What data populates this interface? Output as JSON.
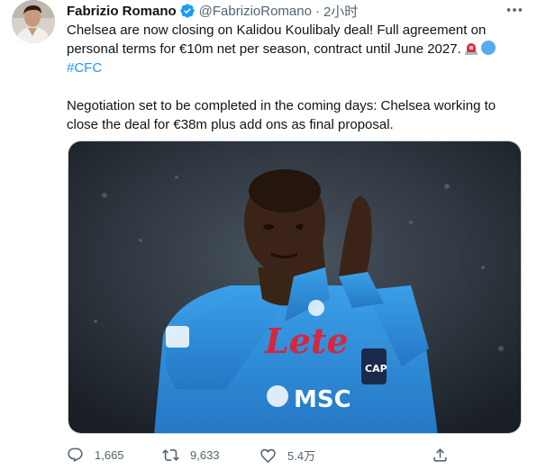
{
  "tweet": {
    "author_name": "Fabrizio Romano",
    "handle": "@FabrizioRomano",
    "separator": "·",
    "time": "2小时",
    "line1": "Chelsea are now closing on Kalidou Koulibaly deal! Full agreement on personal terms for €10m net per season, contract until June 2027.",
    "hashtag": "#CFC",
    "para2": "Negotiation set to be completed in the coming days: Chelsea working to close the deal for €38m plus add ons as final proposal."
  },
  "media": {
    "jersey_sponsor": "Lete",
    "jersey_logo": "MSC",
    "armband": "CAP"
  },
  "actions": {
    "reply_count": "1,665",
    "retweet_count": "9,633",
    "like_count": "5.4万"
  },
  "icons": {
    "verified": "verified-badge-icon",
    "more": "more-icon",
    "reply": "reply-icon",
    "retweet": "retweet-icon",
    "like": "like-icon",
    "share": "share-icon"
  },
  "colors": {
    "verified_blue": "#1d9bf0",
    "hashtag_blue": "#1d9bf0",
    "secondary_text": "#536471",
    "jersey_blue": "#2f8fd8"
  }
}
